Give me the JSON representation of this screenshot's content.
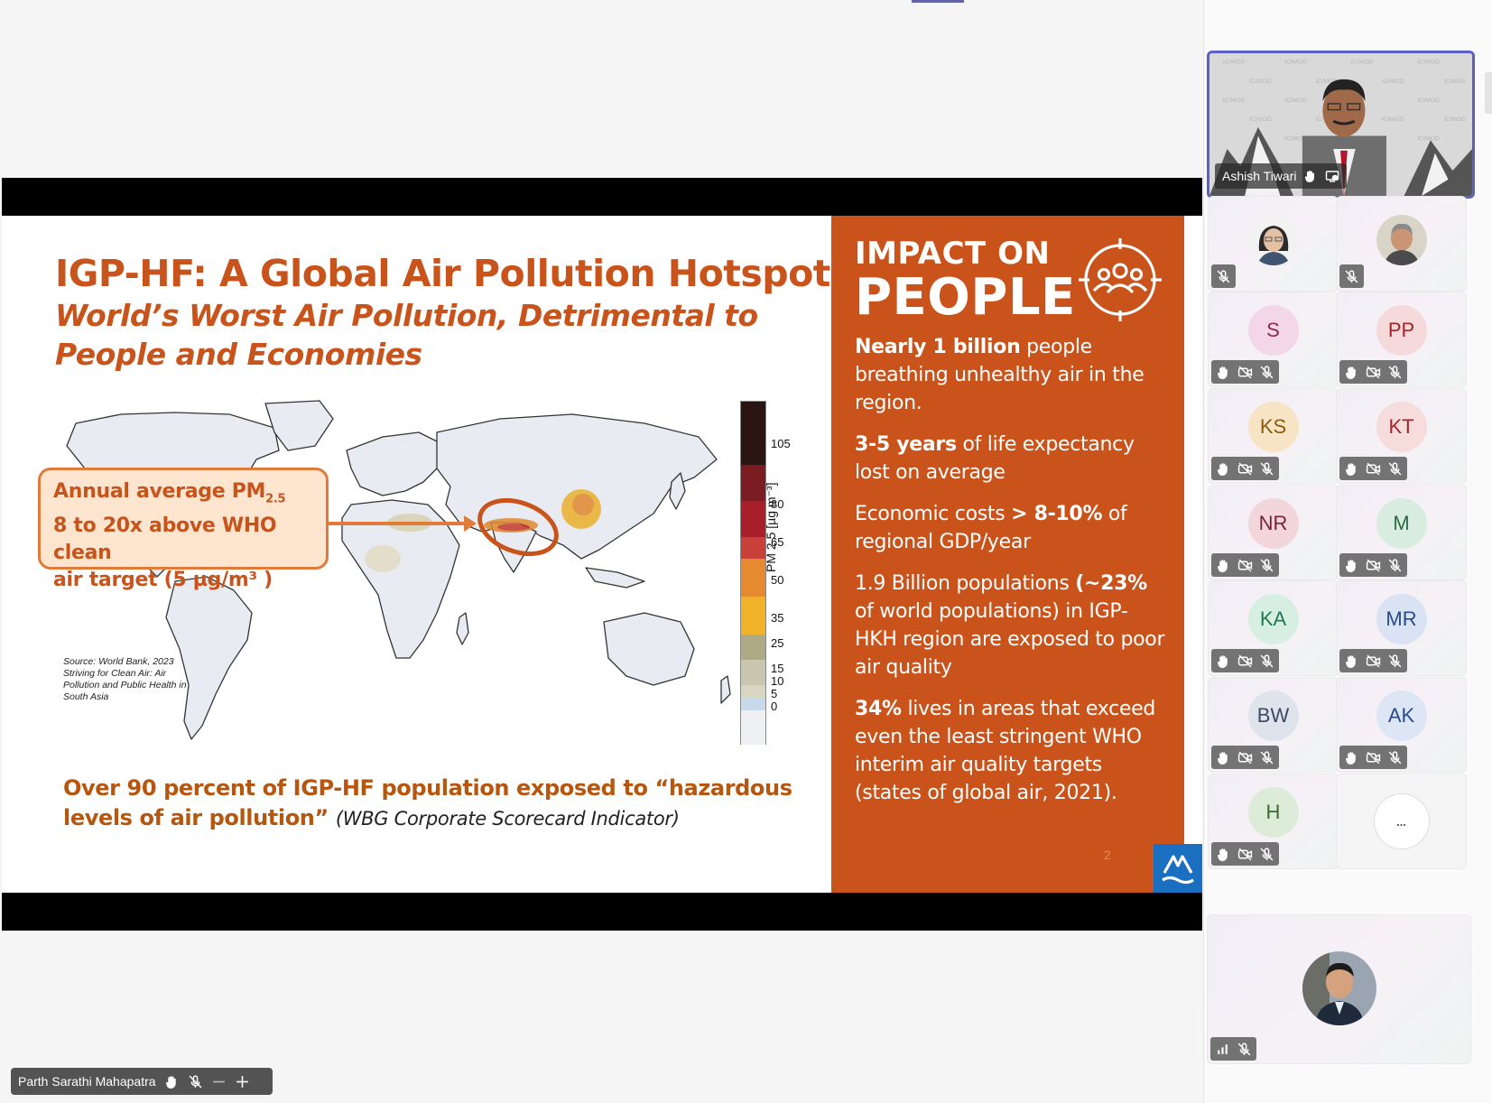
{
  "slide": {
    "title": "IGP-HF: A Global Air Pollution Hotspot",
    "subtitle": "World’s Worst Air Pollution, Detrimental to People and Economies",
    "callout": {
      "line1": "Annual average PM",
      "line1_sub": "2.5",
      "line2": "8 to 20x above WHO clean",
      "line3": "air target (5 µg/m³ )"
    },
    "source": "Source: World Bank, 2023 Striving for Clean Air: Air Pollution and Public Health in South Asia",
    "colorbar": {
      "label": "PM 2.5 [µg m⁻³]",
      "ticks": [
        "105",
        "80",
        "65",
        "50",
        "35",
        "25",
        "15",
        "10",
        "5",
        "0"
      ],
      "colors": [
        "#2a1512",
        "#7a1c22",
        "#a81f29",
        "#c93f3a",
        "#e58a2f",
        "#efb228",
        "#aeaa86",
        "#c9c7b0",
        "#d8d5c2",
        "#c8daea",
        "#eef0f4"
      ]
    },
    "bottom_note_bold": "Over 90 percent of IGP-HF population exposed to “hazardous levels of air pollution”",
    "bottom_note_italic": "(WBG Corporate Scorecard Indicator)",
    "panel": {
      "heading_small": "IMPACT ON",
      "heading_big": "PEOPLE",
      "p1_bold": "Nearly 1 billion",
      "p1_rest": " people breathing unhealthy air in the region.",
      "p2_bold": "3-5 years",
      "p2_rest": " of life expectancy lost on average",
      "p3_pre": "Economic costs ",
      "p3_bold": "> 8-10%",
      "p3_rest": " of regional GDP/year",
      "p4_pre": "1.9 Billion populations ",
      "p4_bold": "(~23%",
      "p4_rest": " of world populations) in IGP-HKH region are exposed to poor air quality",
      "p5_bold": "34%",
      "p5_rest": " lives in areas that exceed even the least stringent WHO interim air quality targets (states of global air, 2021).",
      "page_number": "2"
    }
  },
  "presenter": {
    "name": "Parth Sarathi Mahapatra"
  },
  "gallery": {
    "speaker": {
      "name": "Ashish Tiwari"
    },
    "tiles": [
      {
        "initials": "",
        "photo": "woman",
        "muted": true
      },
      {
        "initials": "",
        "photo": "man-gray",
        "muted": true
      },
      {
        "initials": "S",
        "bg": "#f3d6e8",
        "fg": "#8a2a5a"
      },
      {
        "initials": "PP",
        "bg": "#f6d9da",
        "fg": "#a3232b"
      },
      {
        "initials": "KS",
        "bg": "#f7e4c4",
        "fg": "#8a5a10"
      },
      {
        "initials": "KT",
        "bg": "#f6dcdb",
        "fg": "#a3232b"
      },
      {
        "initials": "NR",
        "bg": "#f3d6dc",
        "fg": "#7a1f3a"
      },
      {
        "initials": "M",
        "bg": "#d8ecdf",
        "fg": "#2b6b46"
      },
      {
        "initials": "KA",
        "bg": "#d6efe2",
        "fg": "#237a4d"
      },
      {
        "initials": "MR",
        "bg": "#d9e3f4",
        "fg": "#2b4a8a"
      },
      {
        "initials": "BW",
        "bg": "#dfe4ec",
        "fg": "#3b4a62"
      },
      {
        "initials": "AK",
        "bg": "#dce6f5",
        "fg": "#2a4c8c"
      },
      {
        "initials": "H",
        "bg": "#dcecd8",
        "fg": "#3a6a30"
      }
    ],
    "more_label": "..."
  },
  "icons": {
    "speaker": [
      "raised-hand-icon",
      "screen-share-icon"
    ],
    "tile": [
      "raised-hand-icon",
      "camera-off-icon",
      "mic-off-icon"
    ],
    "nametag": [
      "raised-hand-icon",
      "mic-off-icon",
      "minus-icon",
      "plus-icon"
    ]
  }
}
